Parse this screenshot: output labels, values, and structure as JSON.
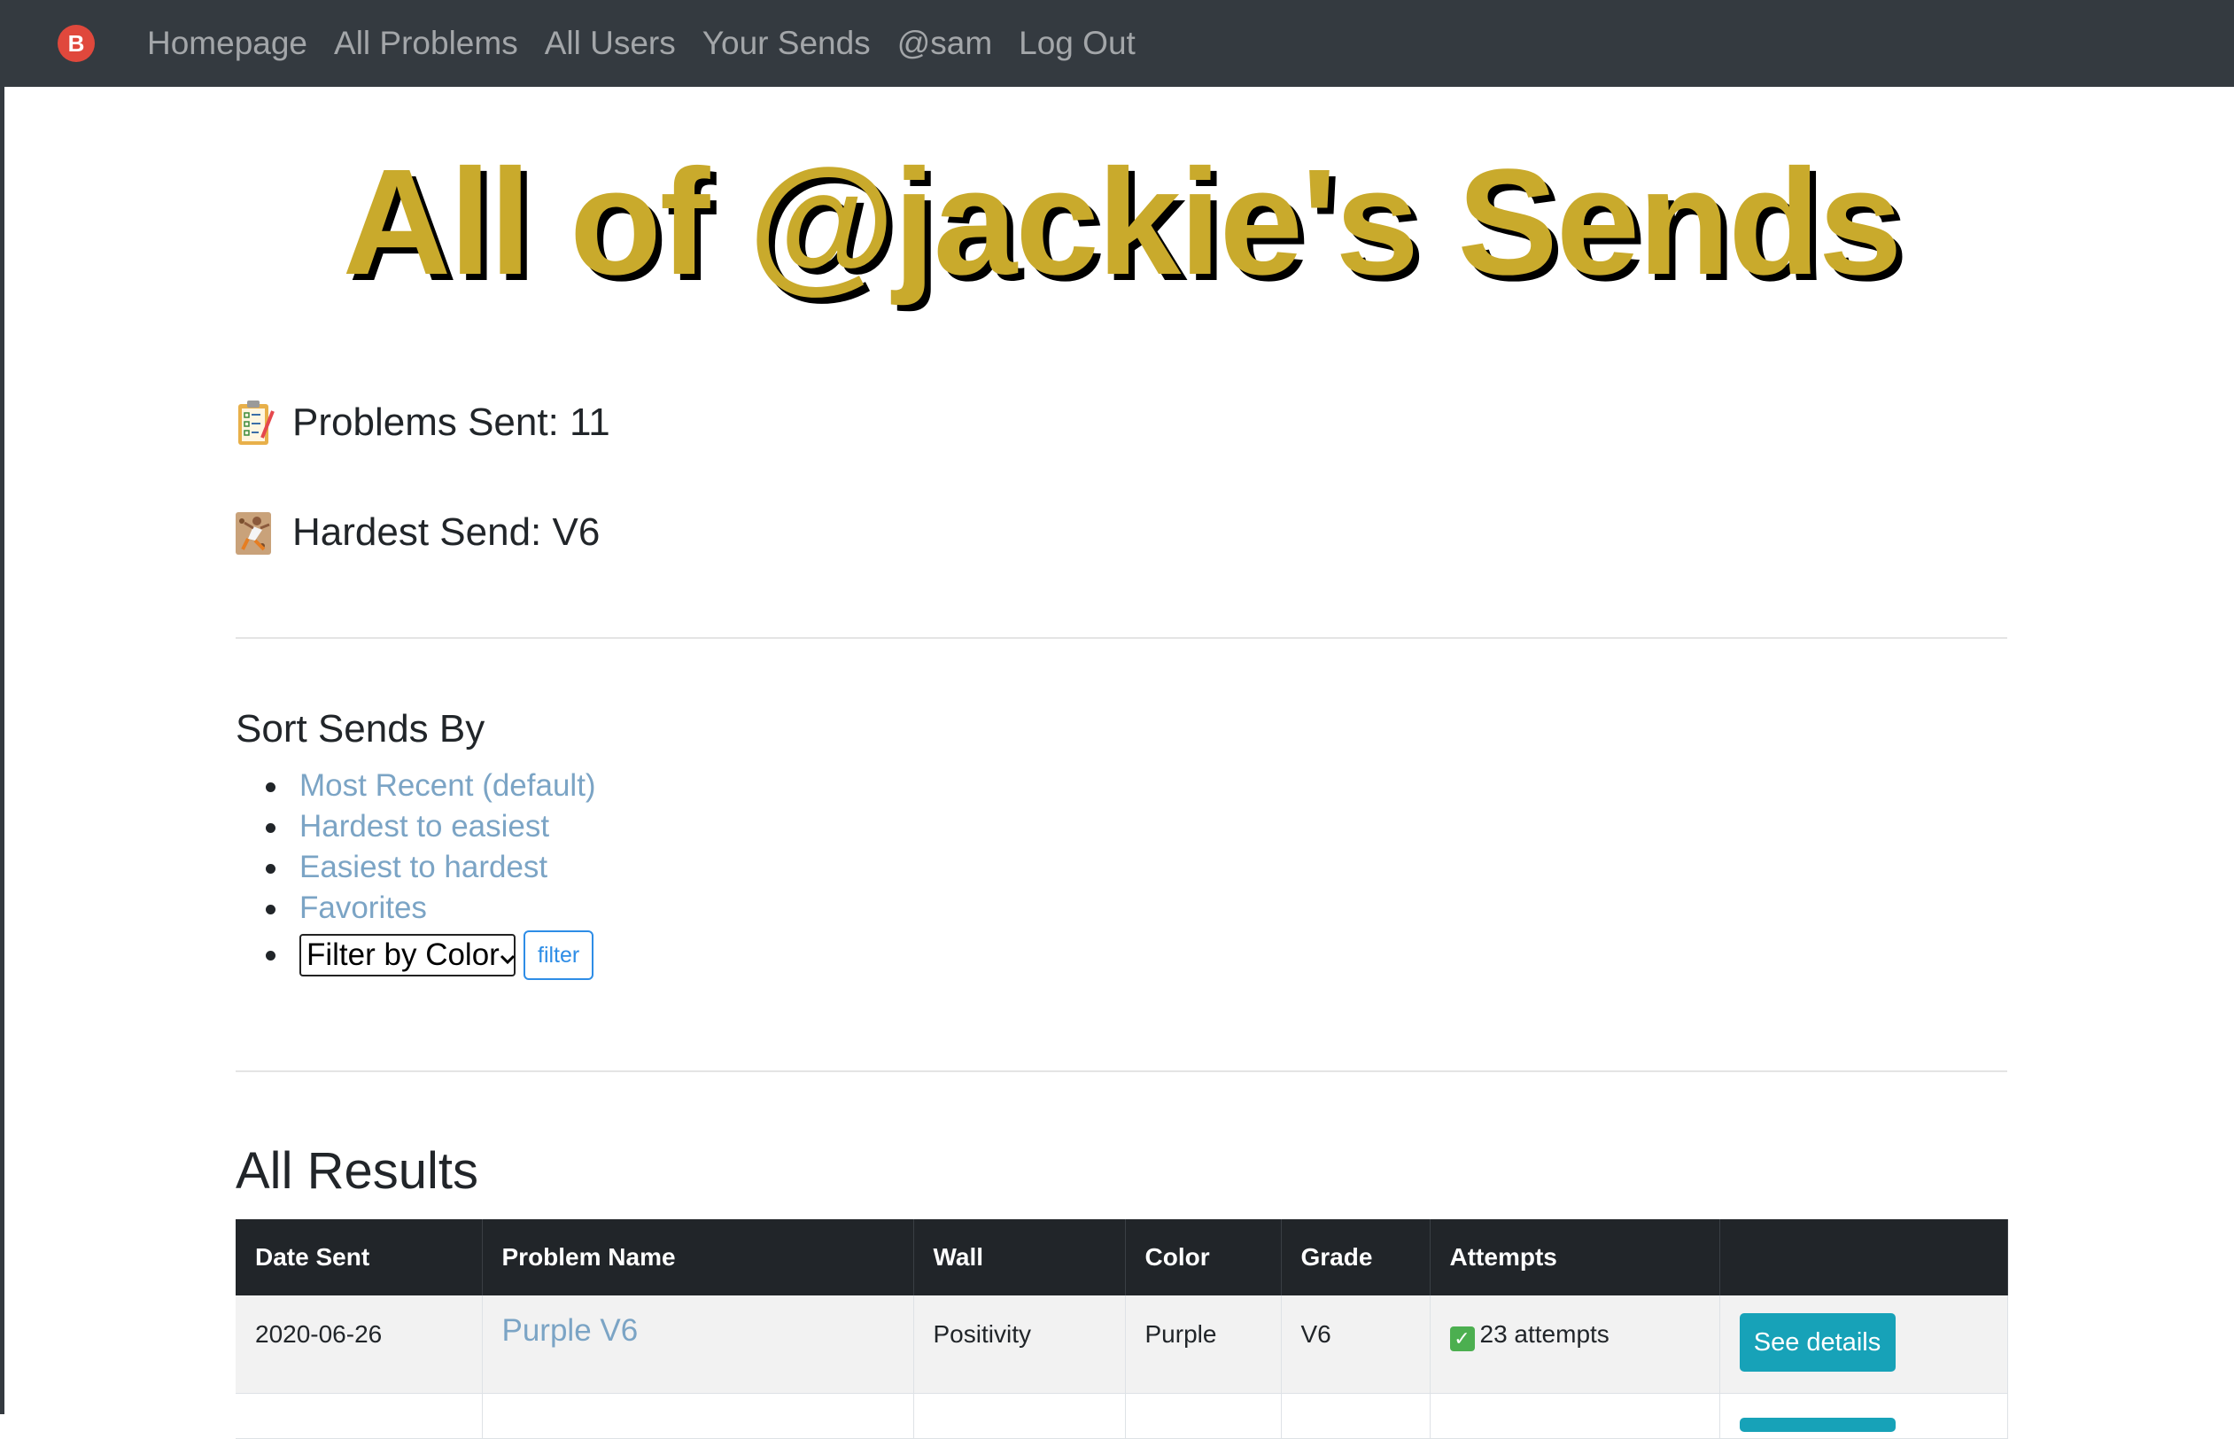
{
  "nav": {
    "logo_letter": "B",
    "links": [
      "Homepage",
      "All Problems",
      "All Users",
      "Your Sends",
      "@sam",
      "Log Out"
    ]
  },
  "page_title": "All of @jackie's Sends",
  "stats": {
    "problems_sent": "Problems Sent: 11",
    "hardest_send": "Hardest Send: V6"
  },
  "sort": {
    "title": "Sort Sends By",
    "options": [
      "Most Recent (default)",
      "Hardest to easiest",
      "Easiest to hardest",
      "Favorites"
    ],
    "filter_select_value": "Filter by Color",
    "filter_button": "filter"
  },
  "results": {
    "title": "All Results",
    "columns": [
      "Date Sent",
      "Problem Name",
      "Wall",
      "Color",
      "Grade",
      "Attempts",
      ""
    ],
    "rows": [
      {
        "date": "2020-06-26",
        "problem": "Purple V6",
        "wall": "Positivity",
        "color": "Purple",
        "grade": "V6",
        "attempts": "23 attempts",
        "action": "See details"
      }
    ]
  },
  "colors": {
    "navbar": "#343a40",
    "title_gold": "#c9aa2c",
    "link": "#7ba4c5",
    "button_info": "#17a2b8",
    "table_header": "#212529"
  },
  "icons": {
    "logo": "brand-logo-icon",
    "problems_sent": "clipboard-checklist-icon",
    "hardest_send": "climber-icon",
    "attempts": "check-mark-icon"
  }
}
